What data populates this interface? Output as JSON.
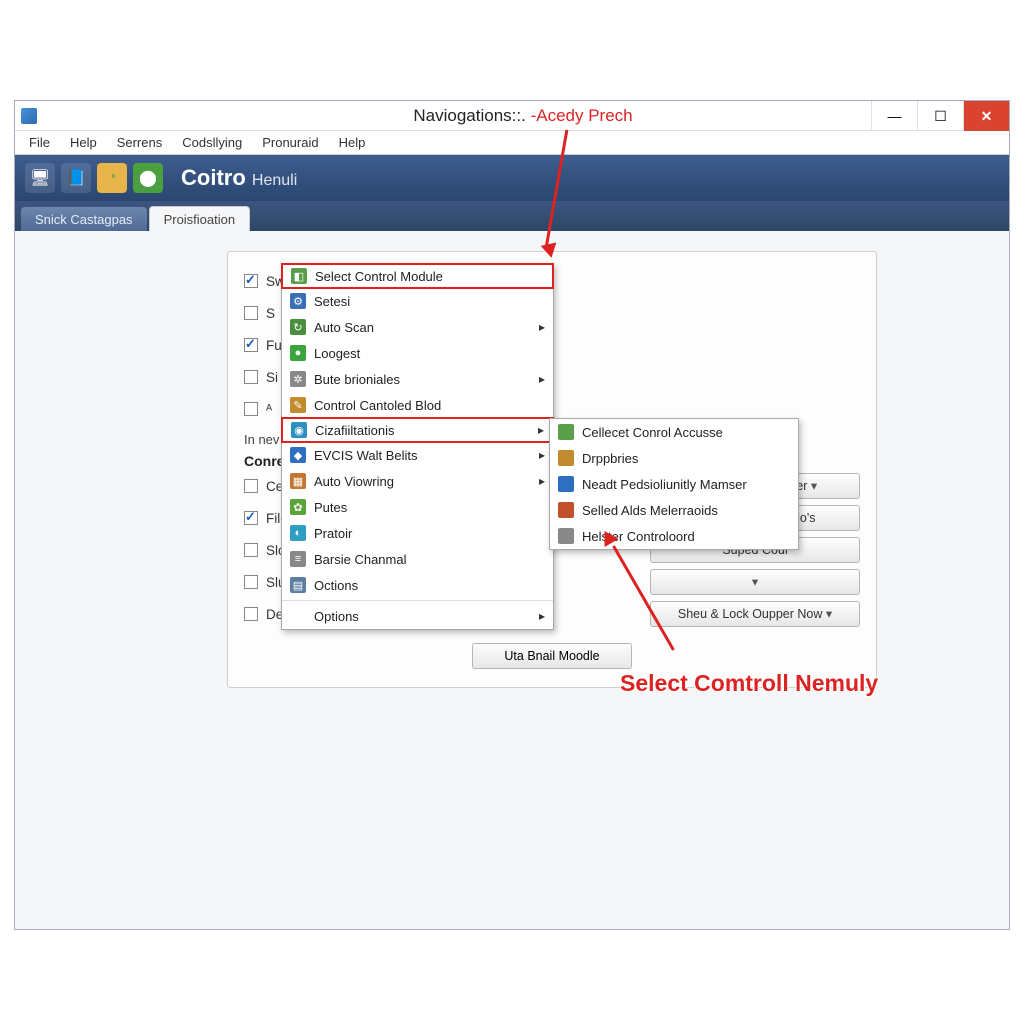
{
  "title": {
    "black": "Naviogations::.",
    "red": "-Acedy Prech"
  },
  "window_buttons": {
    "min": "—",
    "max": "☐",
    "close": "✕"
  },
  "menubar": [
    "File",
    "Help",
    "Serrens",
    "Codsllying",
    "Pronuraid",
    "Help"
  ],
  "toolbar_brand": {
    "main": "Coitro",
    "sub": "Henuli"
  },
  "tabs": {
    "inactive": "Snick Castagpas",
    "active": "Proisfioation"
  },
  "top_icons_text": "🗋 🏠  ≡",
  "left_rows": [
    {
      "checked": true,
      "label": "Sw"
    },
    {
      "checked": false,
      "label": "S"
    },
    {
      "checked": true,
      "label": "Fu"
    },
    {
      "checked": false,
      "label": "Si"
    },
    {
      "checked": false,
      "label": "ᴬ"
    }
  ],
  "lead_text": "In nev",
  "section_title": "Conre",
  "lower_rows": [
    {
      "checked": false,
      "label": "Cenfinira Pamy"
    },
    {
      "checked": true,
      "label": "Filc coor Learns"
    },
    {
      "checked": false,
      "label": "Slork Çopege Hople"
    },
    {
      "checked": false,
      "label": "Sluperst Vaopcan Coptsier"
    },
    {
      "checked": false,
      "label": "Delivatier Ibilling Super"
    }
  ],
  "right_buttons": [
    {
      "label": "ort Aill Sase Monuler",
      "dd": true
    },
    {
      "label": "Inprt |Abust Seconio's",
      "dd": false
    },
    {
      "label": "Suped Coul",
      "dd": false
    },
    {
      "label": " ",
      "dd": true
    },
    {
      "label": "Sheu & Lock Oupper Now",
      "dd": true
    }
  ],
  "footer_button": "Uta Bnail Moodle",
  "dropdown": [
    {
      "label": "Select Control Module",
      "icon": "#5a9e4a",
      "glyph": "◧",
      "hl": true
    },
    {
      "label": "Setesi",
      "icon": "#3b6fb5",
      "glyph": "⚙"
    },
    {
      "label": "Auto Scan",
      "icon": "#4a8f3d",
      "glyph": "↻",
      "sub": true
    },
    {
      "label": "Loogest",
      "icon": "#3aa53a",
      "glyph": "●"
    },
    {
      "label": "Bute brioniales",
      "icon": "#888",
      "glyph": "✲",
      "sub": true
    },
    {
      "label": "Control Cantoled Blod",
      "icon": "#c28b2e",
      "glyph": "✎"
    },
    {
      "label": "Cizafiiltationis",
      "icon": "#2e8fc2",
      "glyph": "◉",
      "sub": true,
      "hl": true
    },
    {
      "label": "EVCIS Walt Belits",
      "icon": "#2e6fc2",
      "glyph": "◆",
      "sub": true
    },
    {
      "label": "Auto Viowring",
      "icon": "#c2762e",
      "glyph": "▦",
      "sub": true
    },
    {
      "label": "Putes",
      "icon": "#5aa53a",
      "glyph": "✿"
    },
    {
      "label": "Pratoir",
      "icon": "#2e9ec2",
      "glyph": "◐"
    },
    {
      "label": "Barsie Chanmal",
      "icon": "#888",
      "glyph": "≡"
    },
    {
      "label": "Octions",
      "icon": "#5a7fa0",
      "glyph": "▤"
    },
    {
      "sep": true
    },
    {
      "label": "Options",
      "icon": "",
      "glyph": "",
      "sub": true
    }
  ],
  "submenu": [
    {
      "label": "Cellecet Conrol Accusse",
      "icon": "#5a9e4a"
    },
    {
      "label": "Drppbries",
      "icon": "#c28b2e"
    },
    {
      "label": "Neadt Pedsioliunitly Mamser",
      "icon": "#2e6fc2"
    },
    {
      "label": "Selled Alds Melerraoids",
      "icon": "#c2522e"
    },
    {
      "label": "Helster Controloord",
      "icon": "#888"
    }
  ],
  "annotation": "Select Comtroll Nemuly"
}
